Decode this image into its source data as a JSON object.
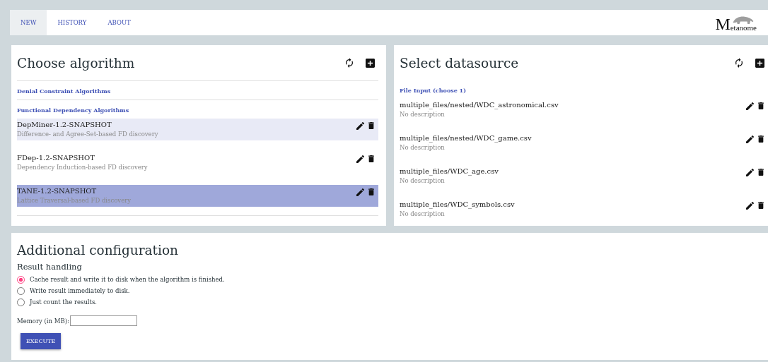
{
  "tabs": [
    {
      "label": "NEW",
      "selected": true
    },
    {
      "label": "HISTORY",
      "selected": false
    },
    {
      "label": "ABOUT",
      "selected": false
    }
  ],
  "logo": {
    "text": "Metanome"
  },
  "algorithm_panel": {
    "title": "Choose algorithm",
    "categories": [
      {
        "label": "Denial Constraint Algorithms"
      },
      {
        "label": "Functional Dependency Algorithms",
        "items": [
          {
            "name": "DepMiner-1.2-SNAPSHOT",
            "description": "Difference- and Agree-Set-based FD discovery",
            "highlighted": true,
            "selected": false
          },
          {
            "name": "FDep-1.2-SNAPSHOT",
            "description": "Dependency Induction-based FD discovery",
            "highlighted": false,
            "selected": false
          },
          {
            "name": "TANE-1.2-SNAPSHOT",
            "description": "Lattice Traversal-based FD discovery",
            "highlighted": false,
            "selected": true
          }
        ]
      }
    ]
  },
  "datasource_panel": {
    "title": "Select datasource",
    "categories": [
      {
        "label": "File Input (choose 1)",
        "items": [
          {
            "name": "multiple_files/nested/WDC_astronomical.csv",
            "description": "No description",
            "selected": false
          },
          {
            "name": "multiple_files/nested/WDC_game.csv",
            "description": "No description",
            "selected": false
          },
          {
            "name": "multiple_files/WDC_age.csv",
            "description": "No description",
            "selected": false
          },
          {
            "name": "multiple_files/WDC_symbols.csv",
            "description": "No description",
            "selected": false
          }
        ]
      }
    ]
  },
  "configuration": {
    "title": "Additional configuration",
    "subtitle": "Result handling",
    "options": [
      {
        "label": "Cache result and write it to disk when the algorithm is finished.",
        "selected": true
      },
      {
        "label": "Write result immediately to disk.",
        "selected": false
      },
      {
        "label": "Just count the results.",
        "selected": false
      }
    ],
    "memory": {
      "label": "Memory (in MB):"
    },
    "button": "EXECUTE"
  }
}
